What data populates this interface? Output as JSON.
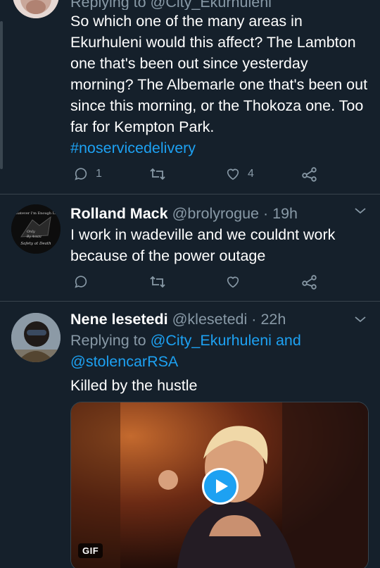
{
  "tweet1": {
    "replying_partial": "Replying to @City_Ekurhuleni",
    "text": "So which one of the many areas in Ekurhuleni would this affect? The Lambton one that's been out since yesterday morning? The Albemarle one that's been out since this morning, or the Thokoza one. Too far for Kempton Park.",
    "hashtag": "#noservicedelivery",
    "reply_count": "1",
    "like_count": "4"
  },
  "tweet2": {
    "name": "Rolland Mack",
    "handle": "@brolyrogue",
    "sep": "·",
    "time": "19h",
    "text": "I work in wadeville and we couldnt work because of the power outage",
    "avatar_text": {
      "top": "Whatever I'm Enough Life",
      "mid1": "Only",
      "mid2": "By Assau",
      "bottom": "Safety at Death"
    }
  },
  "tweet3": {
    "name": "Nene lesetedi",
    "handle": "@klesetedi",
    "sep": "·",
    "time": "22h",
    "replying_label": "Replying to",
    "reply_to_1": "@City_Ekurhuleni",
    "and_label": "and",
    "reply_to_2": "@stolencarRSA",
    "text": "Killed by the hustle",
    "media_badge": "GIF"
  },
  "colors": {
    "background": "#15202b",
    "accent": "#1da1f2",
    "muted": "#8899a6",
    "divider": "#38444d"
  },
  "icons": [
    "reply-icon",
    "retweet-icon",
    "like-icon",
    "share-icon",
    "chevron-down-icon",
    "play-icon"
  ]
}
